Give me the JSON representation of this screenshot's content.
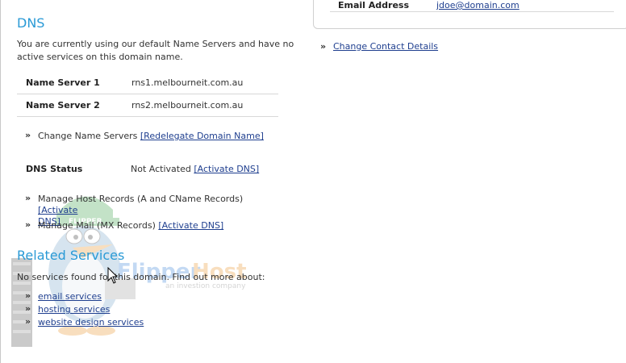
{
  "right_panel": {
    "email_label": "Email Address",
    "email_value": "jdoe@domain.com",
    "change_contact_label": "Change Contact Details"
  },
  "dns": {
    "heading": "DNS",
    "intro": "You are currently using our default Name Servers and have no active services on this domain name.",
    "name_servers": [
      {
        "label": "Name Server 1",
        "value": "rns1.melbourneit.com.au"
      },
      {
        "label": "Name Server 2",
        "value": "rns2.melbourneit.com.au"
      }
    ],
    "change_ns_text": "Change Name Servers",
    "redelegate_link": "[Redelegate Domain Name]",
    "status_label": "DNS Status",
    "status_value": "Not Activated",
    "activate_link": "[Activate DNS]",
    "host_records_text": "Manage Host Records (A and CName Records)",
    "host_records_link_1": "[Activate",
    "host_records_link_2": "DNS]",
    "mail_text": "Manage Mail (MX Records)",
    "mail_link": "[Activate DNS]"
  },
  "related": {
    "heading": "Related Services",
    "intro": "No services found for this domain. Find out more about:",
    "links": [
      "email services",
      "hosting services",
      "website design services"
    ]
  },
  "watermark": {
    "brand_1": "Flipper",
    "brand_2": "Host",
    "tagline": "an investion company",
    "cap_text": "FLIPPER"
  },
  "bullet_glyph": "»",
  "colors": {
    "heading": "#2a9ad6",
    "link": "#1f3f8f",
    "text": "#333333"
  }
}
